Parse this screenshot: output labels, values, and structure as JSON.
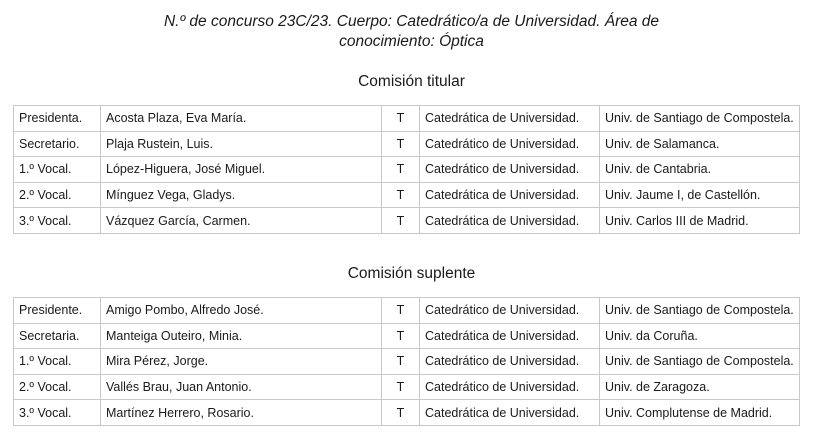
{
  "title": {
    "line1": "N.º de concurso 23C/23. Cuerpo: Catedrático/a de Universidad. Área de",
    "line2": "conocimiento: Óptica"
  },
  "comision_titular": {
    "heading": "Comisión titular",
    "rows": [
      {
        "cargo": "Presidenta.",
        "nombre": "Acosta Plaza, Eva María.",
        "tipo": "T",
        "cuerpo": "Catedrática de Universidad.",
        "universidad": "Univ. de Santiago de Compostela."
      },
      {
        "cargo": "Secretario.",
        "nombre": "Plaja Rustein, Luis.",
        "tipo": "T",
        "cuerpo": "Catedrático de Universidad.",
        "universidad": "Univ. de Salamanca."
      },
      {
        "cargo": "1.º Vocal.",
        "nombre": "López-Higuera, José Miguel.",
        "tipo": "T",
        "cuerpo": "Catedrático de Universidad.",
        "universidad": "Univ. de Cantabria."
      },
      {
        "cargo": "2.º Vocal.",
        "nombre": "Mínguez Vega, Gladys.",
        "tipo": "T",
        "cuerpo": "Catedrática de Universidad.",
        "universidad": "Univ. Jaume I, de Castellón."
      },
      {
        "cargo": "3.º Vocal.",
        "nombre": "Vázquez García, Carmen.",
        "tipo": "T",
        "cuerpo": "Catedrática de Universidad.",
        "universidad": "Univ. Carlos III de Madrid."
      }
    ]
  },
  "comision_suplente": {
    "heading": "Comisión suplente",
    "rows": [
      {
        "cargo": "Presidente.",
        "nombre": "Amigo Pombo, Alfredo José.",
        "tipo": "T",
        "cuerpo": "Catedrático de Universidad.",
        "universidad": "Univ. de Santiago de Compostela."
      },
      {
        "cargo": "Secretaria.",
        "nombre": "Manteiga Outeiro, Minia.",
        "tipo": "T",
        "cuerpo": "Catedrática de Universidad.",
        "universidad": "Univ. da Coruña."
      },
      {
        "cargo": "1.º Vocal.",
        "nombre": "Mira Pérez, Jorge.",
        "tipo": "T",
        "cuerpo": "Catedrático de Universidad.",
        "universidad": "Univ. de Santiago de Compostela."
      },
      {
        "cargo": "2.º Vocal.",
        "nombre": "Vallés Brau, Juan Antonio.",
        "tipo": "T",
        "cuerpo": "Catedrático de Universidad.",
        "universidad": "Univ. de Zaragoza."
      },
      {
        "cargo": "3.º Vocal.",
        "nombre": "Martínez Herrero, Rosario.",
        "tipo": "T",
        "cuerpo": "Catedrática de Universidad.",
        "universidad": "Univ. Complutense de Madrid."
      }
    ]
  }
}
